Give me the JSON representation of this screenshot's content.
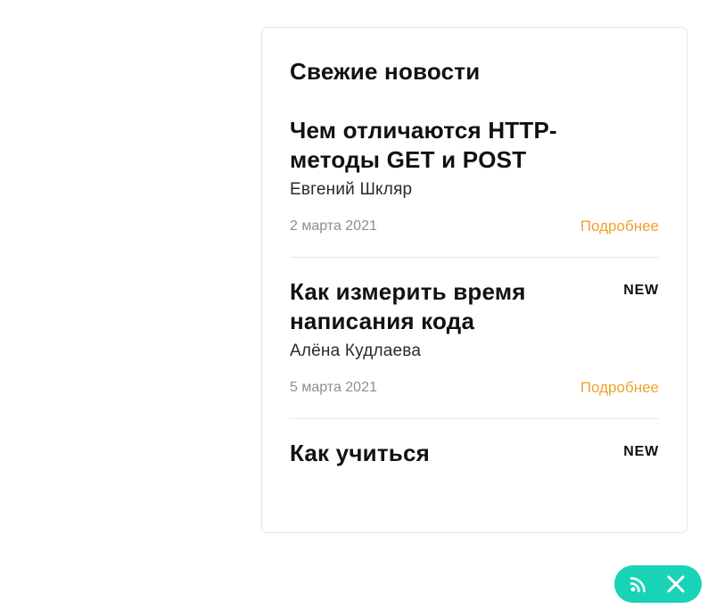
{
  "news_card": {
    "title": "Свежие новости",
    "items": [
      {
        "title": "Чем отличаются HTTP-методы GET и POST",
        "author": "Евгений Шкляр",
        "date": "2 марта 2021",
        "more_label": "Подробнее",
        "badge": ""
      },
      {
        "title": "Как измерить время написания кода",
        "author": "Алёна Кудлаева",
        "date": "5 марта 2021",
        "more_label": "Подробнее",
        "badge": "NEW"
      },
      {
        "title": "Как учиться",
        "badge": "NEW"
      }
    ]
  },
  "floating_bar": {
    "rss_icon": "rss-icon",
    "close_icon": "close-icon",
    "color": "#19d3b6"
  },
  "colors": {
    "accent_link": "#f0a22e",
    "date_text": "#8e8e8e"
  }
}
